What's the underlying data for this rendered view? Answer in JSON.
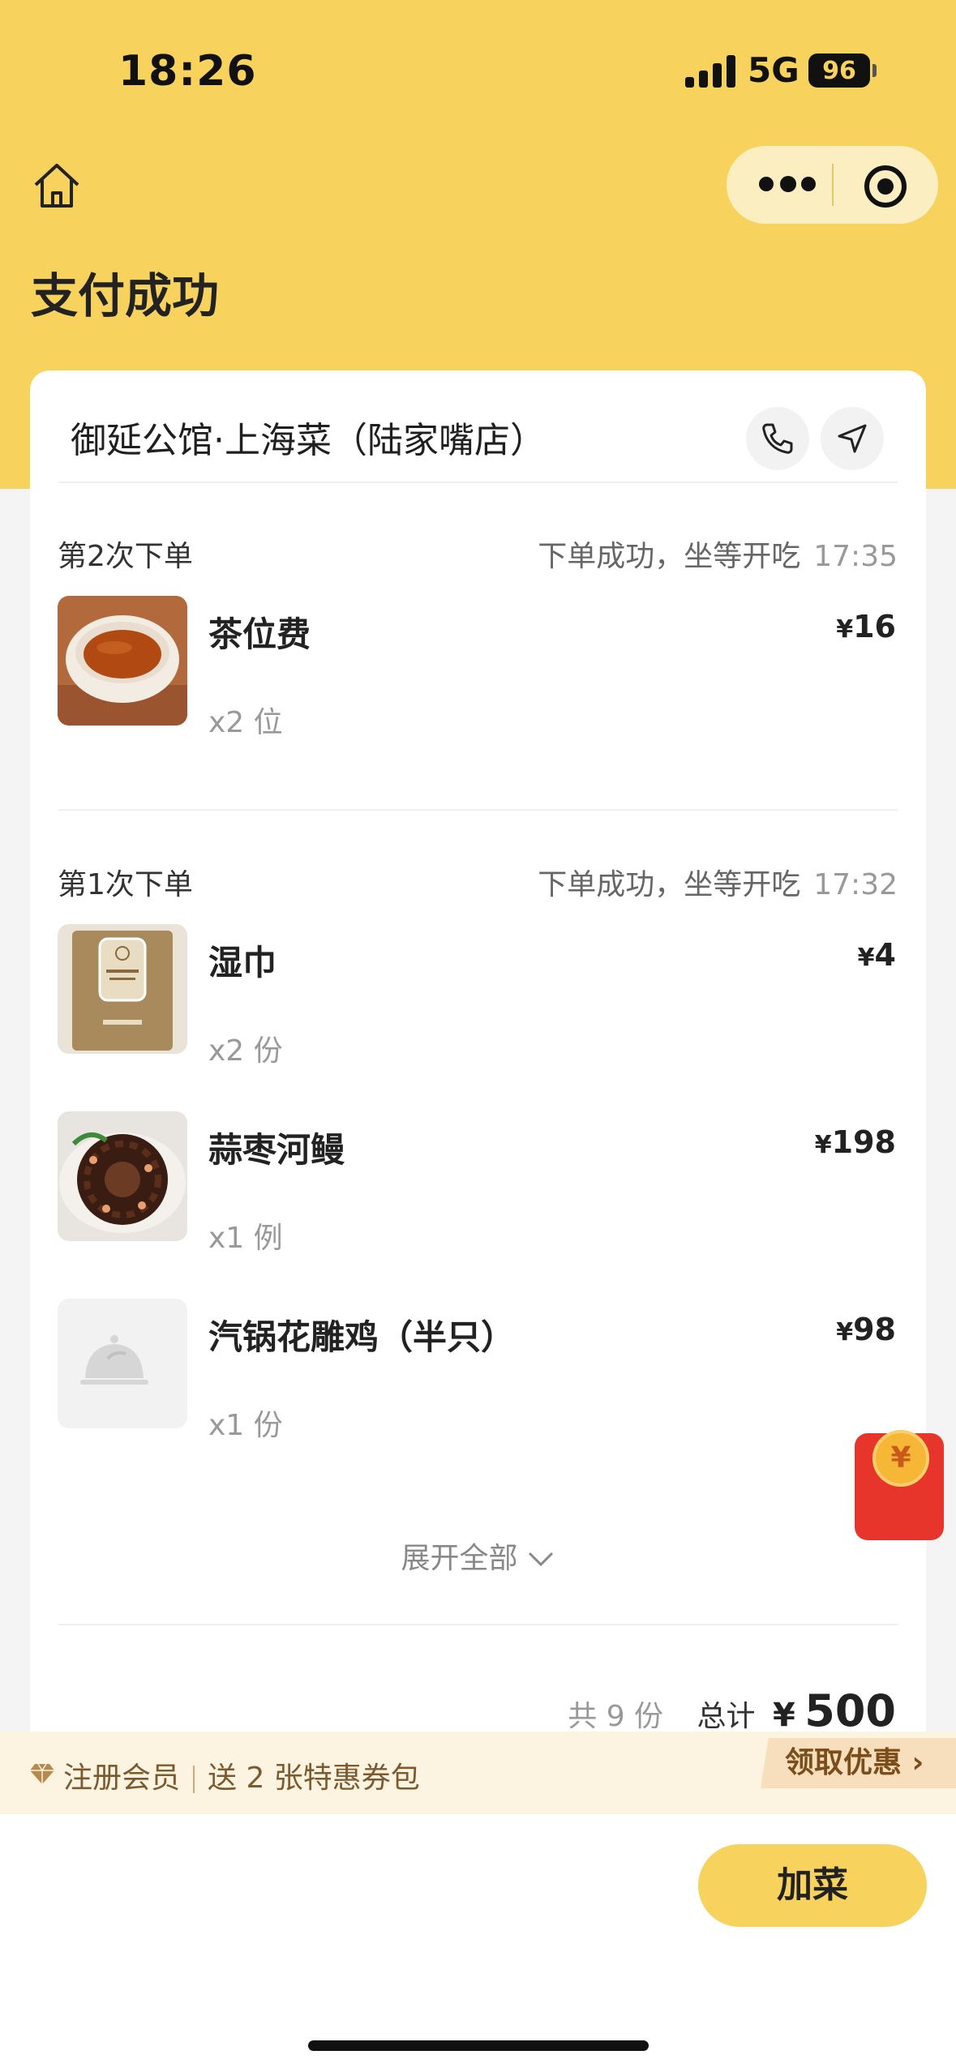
{
  "status_bar": {
    "time": "18:26",
    "network": "5G",
    "battery": "96"
  },
  "header": {
    "title": "支付成功"
  },
  "store": {
    "name": "御延公馆·上海菜（陆家嘴店）"
  },
  "orders": [
    {
      "title": "第2次下单",
      "status": "下单成功，坐等开吃",
      "time": "17:35",
      "items": [
        {
          "name": "茶位费",
          "qty": "x2 位",
          "currency": "¥",
          "price": "16"
        }
      ]
    },
    {
      "title": "第1次下单",
      "status": "下单成功，坐等开吃",
      "time": "17:32",
      "items": [
        {
          "name": "湿巾",
          "qty": "x2 份",
          "currency": "¥",
          "price": "4"
        },
        {
          "name": "蒜枣河鳗",
          "qty": "x1 例",
          "currency": "¥",
          "price": "198"
        },
        {
          "name": "汽锅花雕鸡（半只）",
          "qty": "x1 份",
          "currency": "¥",
          "price": "98"
        }
      ]
    }
  ],
  "expand_label": "展开全部",
  "summary": {
    "count_text": "共 9 份",
    "total_label": "总计",
    "currency": "¥",
    "total": "500"
  },
  "member": {
    "register": "注册会员",
    "offer": "送 2 张特惠券包",
    "claim": "领取优惠 ›"
  },
  "actions": {
    "add_dish": "加菜"
  },
  "redpacket": {
    "symbol": "¥"
  }
}
